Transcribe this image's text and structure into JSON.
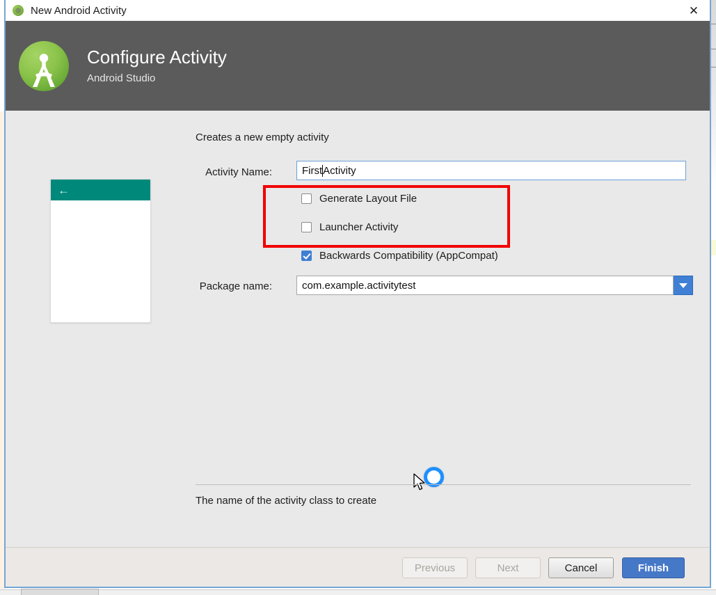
{
  "window": {
    "title": "New Android Activity",
    "title_icon": "android-icon",
    "close_label": "✕"
  },
  "header": {
    "title": "Configure Activity",
    "subtitle": "Android Studio",
    "logo_name": "android-studio-logo",
    "background": "#5b5b5b"
  },
  "body": {
    "description": "Creates a new empty activity",
    "preview": {
      "back_icon": "←",
      "appbar_color": "#00897b"
    },
    "fields": {
      "activity_name_label": "Activity Name:",
      "activity_name_value_before_caret": "First",
      "activity_name_value_after_caret": "Activity",
      "package_name_label": "Package name:",
      "package_name_value": "com.example.activitytest",
      "package_dropdown_icon": "chevron-down-icon"
    },
    "checkboxes": [
      {
        "label": "Generate Layout File",
        "checked": false
      },
      {
        "label": "Launcher Activity",
        "checked": false
      },
      {
        "label": "Backwards Compatibility (AppCompat)",
        "checked": true
      }
    ],
    "hint": "The name of the activity class to create",
    "annotation_color": "#f20000"
  },
  "footer": {
    "previous_label": "Previous",
    "next_label": "Next",
    "cancel_label": "Cancel",
    "finish_label": "Finish"
  },
  "cursor": {
    "state": "busy",
    "busy_color": "#1e90ff"
  },
  "colors": {
    "accent_blue": "#3f7fd4",
    "primary_button": "#4678c8",
    "dialog_background": "#e9e9e9",
    "teal": "#00897b"
  }
}
